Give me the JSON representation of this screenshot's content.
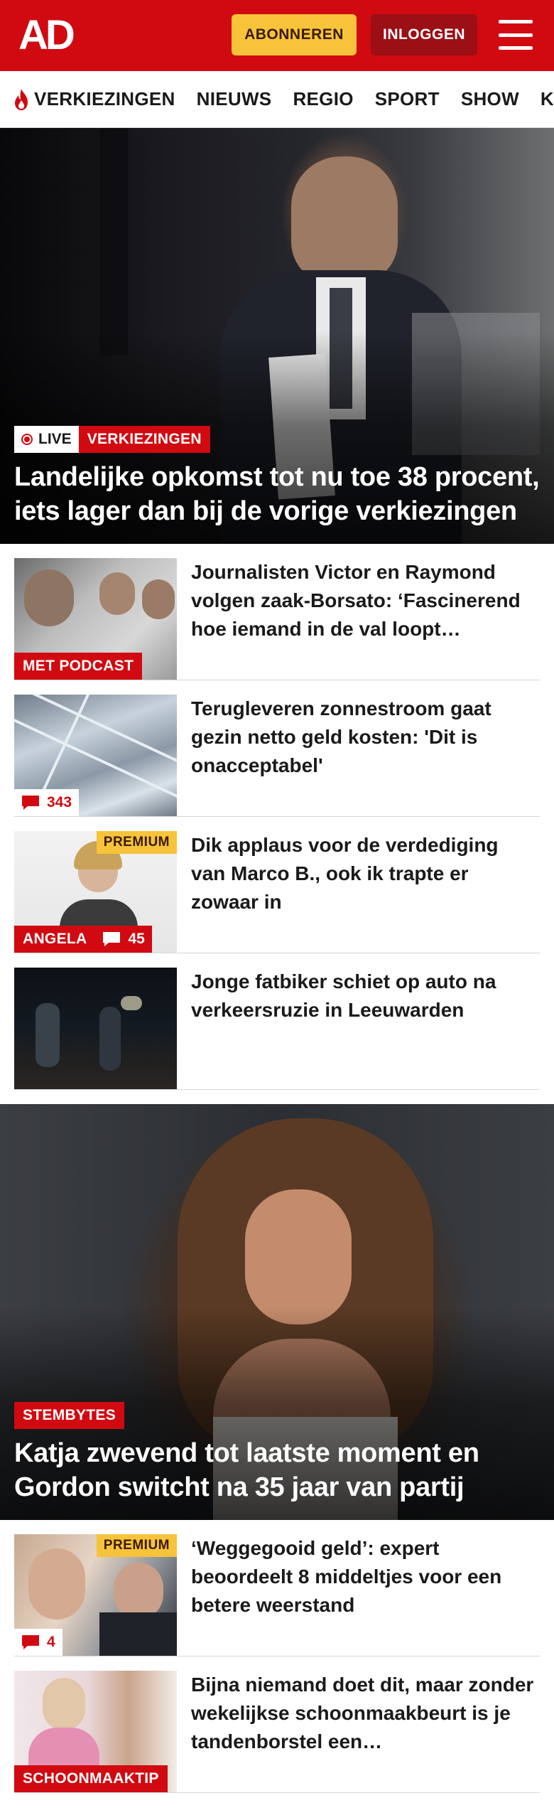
{
  "header": {
    "logo": "AD",
    "subscribe_label": "ABONNEREN",
    "login_label": "INLOGGEN"
  },
  "nav": {
    "items": [
      "VERKIEZINGEN",
      "NIEUWS",
      "REGIO",
      "SPORT",
      "SHOW",
      "KIJK"
    ]
  },
  "hero1": {
    "live_label": "LIVE",
    "tag": "VERKIEZINGEN",
    "title": "Landelijke opkomst tot nu toe 38 procent, iets lager dan bij de vorige verkiezingen"
  },
  "articles1": [
    {
      "title": "Journalisten Victor en Raymond volgen zaak-Borsato: ‘Fascine­rend hoe iemand in de val loopt…",
      "badge": "MET PODCAST"
    },
    {
      "title": "Terugleveren zonnestroom gaat gezin netto geld kosten: 'Dit is onacceptabel'",
      "comments": "343"
    },
    {
      "title": "Dik applaus voor de verdediging van Marco B., ook ik trapte er zowaar in",
      "badge": "ANGELA",
      "comments": "45",
      "premium": "PREMIUM"
    },
    {
      "title": "Jonge fatbiker schiet op auto na verkeersruzie in Leeuwarden"
    }
  ],
  "hero2": {
    "tag": "STEMBYTES",
    "title": "Katja zwevend tot laatste moment en Gordon switcht na 35 jaar van partij"
  },
  "articles2": [
    {
      "title": "‘Weggegooid geld’: expert beoordeelt 8 middeltjes voor een betere weerstand",
      "comments": "4",
      "premium": "PREMIUM"
    },
    {
      "title": "Bijna niemand doet dit, maar zonder wekelijkse schoonmaak­beurt is je tandenborstel een…",
      "badge": "SCHOONMAAKTIP"
    }
  ],
  "colors": {
    "brand_red": "#d10a11",
    "premium_yellow": "#f6c33a",
    "login_dark_red": "#9b0f15"
  }
}
